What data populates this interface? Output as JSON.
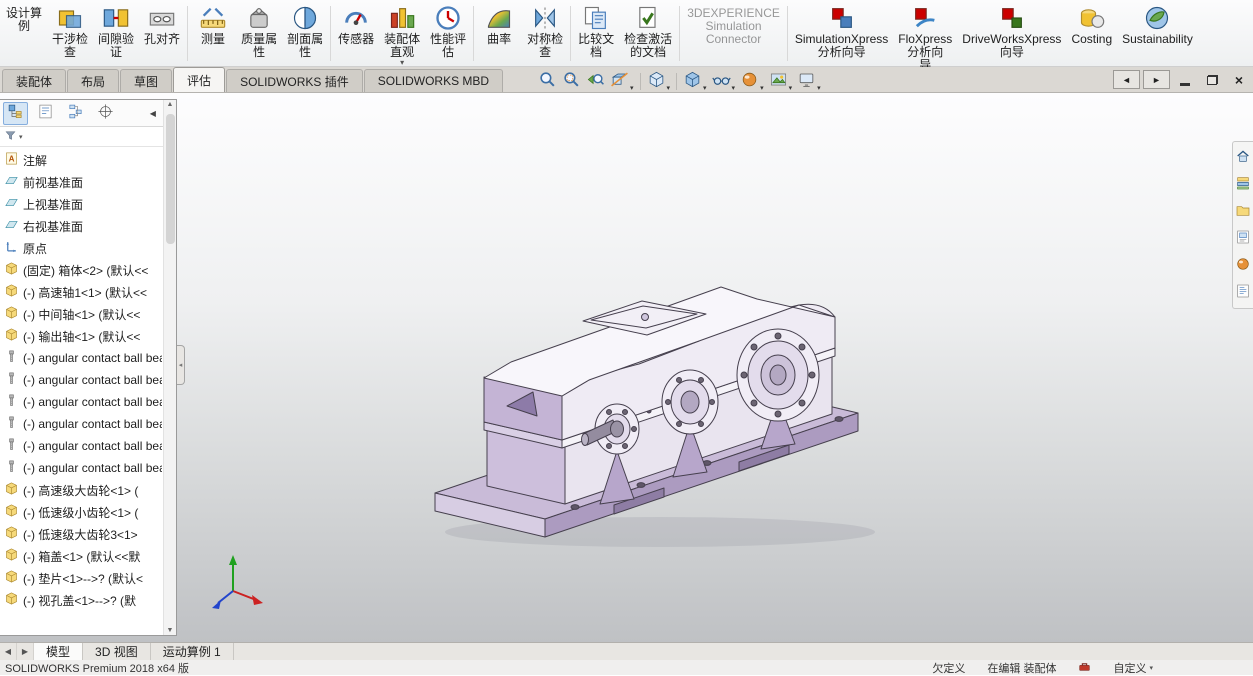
{
  "colors": {
    "model_purple": "#b7a7c8",
    "viewport_top": "#fdfdfe",
    "viewport_bottom": "#bfc1c4",
    "accent_blue": "#2a5783"
  },
  "ribbon": {
    "items": [
      {
        "icon": "design-study",
        "lines": [
          "设计算",
          "例"
        ],
        "no_icon": true
      },
      {
        "icon": "interference-check",
        "lines": [
          "干涉检",
          "查"
        ]
      },
      {
        "icon": "clearance-verify",
        "lines": [
          "间隙验",
          "证"
        ]
      },
      {
        "icon": "hole-alignment",
        "lines": [
          "孔对齐"
        ],
        "sep_after": true
      },
      {
        "icon": "measure",
        "lines": [
          "测量"
        ]
      },
      {
        "icon": "mass-properties",
        "lines": [
          "质量属",
          "性"
        ]
      },
      {
        "icon": "section-properties",
        "lines": [
          "剖面属",
          "性"
        ],
        "sep_after": true
      },
      {
        "icon": "sensor",
        "lines": [
          "传感器"
        ]
      },
      {
        "icon": "assembly-visualization",
        "lines": [
          "装配体",
          "直观"
        ],
        "dropdown": true
      },
      {
        "icon": "performance-evaluation",
        "lines": [
          "性能评",
          "估"
        ],
        "sep_after": true
      },
      {
        "icon": "curvature",
        "lines": [
          "曲率"
        ]
      },
      {
        "icon": "symmetry-check",
        "lines": [
          "对称检",
          "查"
        ],
        "sep_after": true
      },
      {
        "icon": "compare-documents",
        "lines": [
          "比较文",
          "档"
        ]
      },
      {
        "icon": "check-active-document",
        "lines": [
          "检查激活",
          "的文档"
        ],
        "sep_after": true
      },
      {
        "icon": "3dexperience-connector",
        "lines": [
          "3DEXPERIENCE",
          "Simulation",
          "Connector"
        ],
        "no_icon": true,
        "disabled": true,
        "sep_after": true
      },
      {
        "icon": "simulationxpress",
        "lines": [
          "SimulationXpress",
          "分析向导"
        ]
      },
      {
        "icon": "floxpress",
        "lines": [
          "FloXpress",
          "分析向",
          "导"
        ]
      },
      {
        "icon": "driveworksxpress",
        "lines": [
          "DriveWorksXpress",
          "向导"
        ]
      },
      {
        "icon": "costing",
        "lines": [
          "Costing"
        ]
      },
      {
        "icon": "sustainability",
        "lines": [
          "Sustainability"
        ]
      }
    ]
  },
  "command_tabs": [
    {
      "label": "装配体"
    },
    {
      "label": "布局"
    },
    {
      "label": "草图"
    },
    {
      "label": "评估",
      "active": true
    },
    {
      "label": "SOLIDWORKS 插件"
    },
    {
      "label": "SOLIDWORKS MBD"
    }
  ],
  "headsup": {
    "items": [
      {
        "icon": "zoom-fit"
      },
      {
        "icon": "zoom-area"
      },
      {
        "icon": "previous-view"
      },
      {
        "icon": "section-view",
        "dropdown": true
      },
      {
        "separator": true
      },
      {
        "icon": "view-orientation",
        "dropdown": true
      },
      {
        "separator": true
      },
      {
        "icon": "display-style",
        "dropdown": true
      },
      {
        "icon": "hide-show-items",
        "dropdown": true
      },
      {
        "icon": "edit-appearance",
        "dropdown": true
      },
      {
        "icon": "apply-scene",
        "dropdown": true
      },
      {
        "icon": "view-settings",
        "dropdown": true
      }
    ]
  },
  "window_controls": [
    {
      "name": "pane-left",
      "glyph": "◄",
      "framed": true
    },
    {
      "name": "pane-right",
      "glyph": "►",
      "framed": true
    },
    {
      "name": "minimize"
    },
    {
      "name": "restore"
    },
    {
      "name": "close",
      "glyph": "×"
    }
  ],
  "tree": {
    "toolbar": [
      {
        "icon": "featuremanager-tree",
        "active": true
      },
      {
        "icon": "propertymanager"
      },
      {
        "icon": "configurationmanager"
      },
      {
        "icon": "dimxpertmanager"
      }
    ],
    "toolbar_arrows": [
      "◀",
      "▶"
    ],
    "items": [
      {
        "icon": "annotations",
        "label": "注解"
      },
      {
        "icon": "reference-plane",
        "label": "前视基准面"
      },
      {
        "icon": "reference-plane",
        "label": "上视基准面"
      },
      {
        "icon": "reference-plane",
        "label": "右视基准面"
      },
      {
        "icon": "origin",
        "label": "原点"
      },
      {
        "icon": "component-part",
        "label": "(固定) 箱体<2> (默认<<"
      },
      {
        "icon": "component-part",
        "label": "(-) 高速轴1<1> (默认<<"
      },
      {
        "icon": "component-part",
        "label": "(-) 中间轴<1> (默认<<"
      },
      {
        "icon": "component-part",
        "label": "(-) 输出轴<1> (默认<<"
      },
      {
        "icon": "component-bearing",
        "label": "(-) angular contact ball bearing"
      },
      {
        "icon": "component-bearing",
        "label": "(-) angular contact ball bearing"
      },
      {
        "icon": "component-bearing",
        "label": "(-) angular contact ball bearing"
      },
      {
        "icon": "component-bearing",
        "label": "(-) angular contact ball bearing"
      },
      {
        "icon": "component-bearing",
        "label": "(-) angular contact ball bearing"
      },
      {
        "icon": "component-bearing",
        "label": "(-) angular contact ball bearing"
      },
      {
        "icon": "component-part",
        "label": "(-) 高速级大齿轮<1> ("
      },
      {
        "icon": "component-part",
        "label": "(-) 低速级小齿轮<1> ("
      },
      {
        "icon": "component-part",
        "label": "(-) 低速级大齿轮3<1>"
      },
      {
        "icon": "component-part",
        "label": "(-) 箱盖<1> (默认<<默"
      },
      {
        "icon": "component-part",
        "label": "(-) 垫片<1>-->? (默认<"
      },
      {
        "icon": "component-part",
        "label": "(-) 视孔盖<1>-->? (默"
      }
    ]
  },
  "taskpane": {
    "items": [
      {
        "icon": "resources"
      },
      {
        "icon": "design-library"
      },
      {
        "icon": "file-explorer"
      },
      {
        "icon": "view-palette"
      },
      {
        "icon": "appearances"
      },
      {
        "icon": "custom-properties"
      }
    ]
  },
  "bottom_tabs": {
    "nav": [
      "◀",
      "▶"
    ],
    "tabs": [
      {
        "label": "模型",
        "active": true
      },
      {
        "label": "3D 视图"
      },
      {
        "label": "运动算例 1"
      }
    ]
  },
  "statusbar": {
    "left": "SOLIDWORKS Premium 2018 x64 版",
    "right": [
      {
        "label": "欠定义"
      },
      {
        "label": "在编辑 装配体"
      },
      {
        "icon": "toolbox"
      },
      {
        "label": "自定义",
        "dropdown": true
      }
    ]
  }
}
